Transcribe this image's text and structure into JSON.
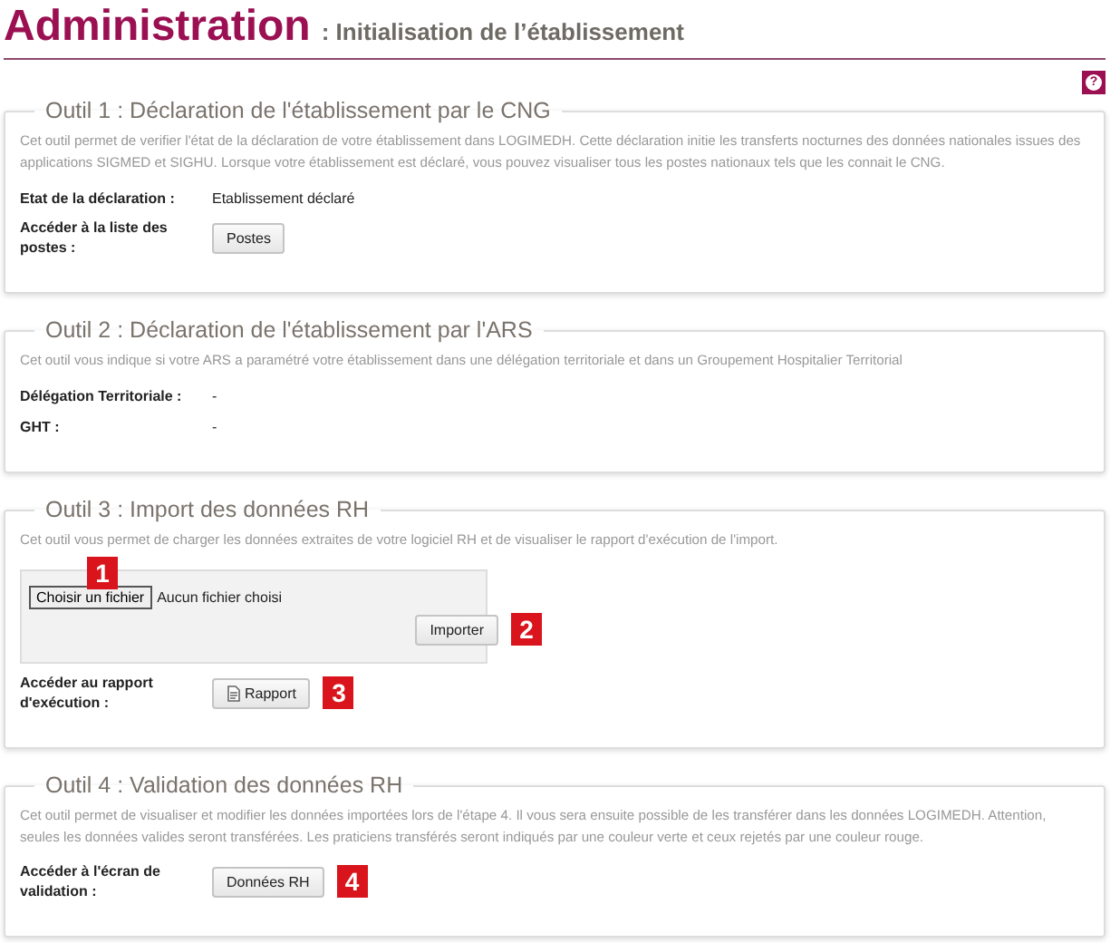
{
  "header": {
    "title": "Administration",
    "subtitle": ": Initialisation de l’établissement"
  },
  "help_button": {
    "label": "?"
  },
  "sections": [
    {
      "legend": "Outil 1 : Déclaration de l'établissement par le CNG",
      "description": "Cet outil permet de verifier l'état de la déclaration de votre établissement dans LOGIMEDH. Cette déclaration initie les transferts nocturnes des données nationales issues des applications SIGMED et SIGHU. Lorsque votre établissement est déclaré, vous pouvez visualiser tous les postes nationaux tels que les connait le CNG.",
      "rows": [
        {
          "kind": "text",
          "label": "Etat de la déclaration :",
          "value": "Etablissement déclaré"
        },
        {
          "kind": "button",
          "label": "Accéder à la liste des postes :",
          "button": "Postes",
          "with_icon": false
        }
      ]
    },
    {
      "legend": "Outil 2 : Déclaration de l'établissement par l'ARS",
      "description": "Cet outil vous indique si votre ARS a paramétré votre établissement dans une délégation territoriale et dans un Groupement Hospitalier Territorial",
      "rows": [
        {
          "kind": "text",
          "label": "Délégation Territoriale :",
          "value": "-"
        },
        {
          "kind": "text",
          "label": "GHT :",
          "value": "-"
        }
      ]
    },
    {
      "legend": "Outil 3 : Import des données RH",
      "description": "Cet outil vous permet de charger les données extraites de votre logiciel RH et de visualiser le rapport d'exécution de l'import.",
      "rows": [
        {
          "kind": "upload",
          "choose_button": "Choisir un fichier",
          "choose_marker": "1",
          "file_status": "Aucun fichier choisi",
          "submit_button": "Importer",
          "submit_marker": "2"
        },
        {
          "kind": "button",
          "label": "Accéder au rapport d'exécution :",
          "button": "Rapport",
          "with_icon": true,
          "marker": "3"
        }
      ]
    },
    {
      "legend": "Outil 4 : Validation des données RH",
      "description": "Cet outil permet de visualiser et modifier les données importées lors de l'étape 4. Il vous sera ensuite possible de les transférer dans les données LOGIMEDH. Attention, seules les données valides seront transférées. Les praticiens transférés seront indiqués par une couleur verte et ceux rejetés par une couleur rouge.",
      "rows": [
        {
          "kind": "button",
          "label": "Accéder à l'écran de validation :",
          "button": "Données RH",
          "with_icon": false,
          "marker": "4"
        }
      ]
    }
  ]
}
